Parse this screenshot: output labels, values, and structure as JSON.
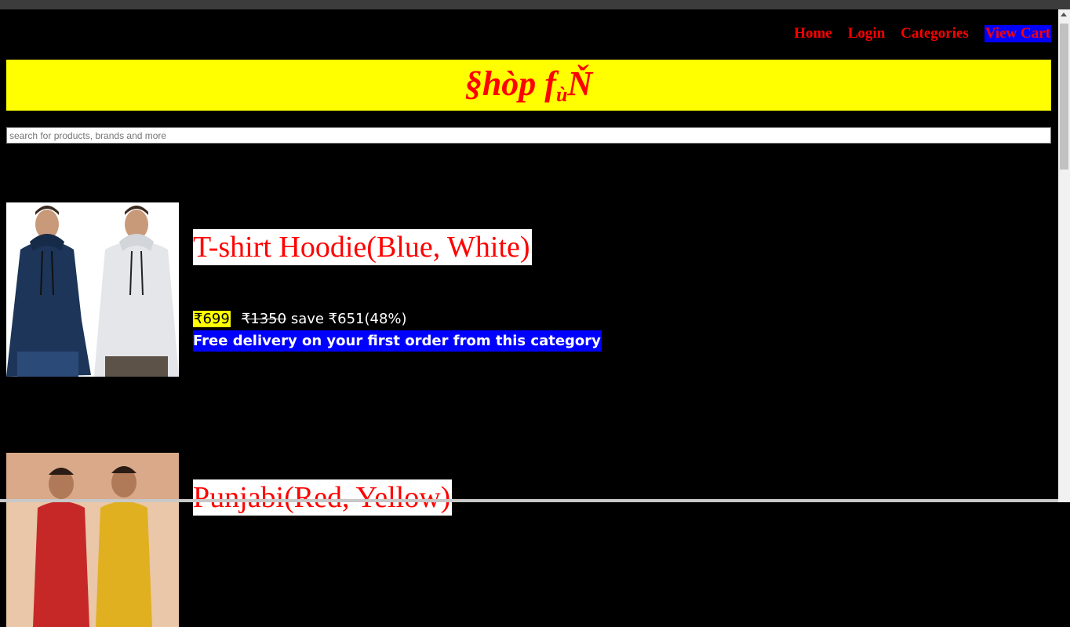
{
  "nav": {
    "home": "Home",
    "login": "Login",
    "categories": "Categories",
    "cart": "View Cart"
  },
  "banner": {
    "title_main": "§hòp f",
    "title_sub": "ù",
    "title_end": "Ň"
  },
  "search": {
    "placeholder": "search for products, brands and more",
    "value": ""
  },
  "products": [
    {
      "name": "T-shirt Hoodie(Blue, White)",
      "price": "₹699",
      "mrp": "₹1350",
      "save": "save ₹651(48%)",
      "delivery": "Free delivery on your first order from this category",
      "image": "hoodie-image"
    },
    {
      "name": "Punjabi(Red, Yellow)",
      "image": "punjabi-image"
    }
  ],
  "colors": {
    "background": "#000000",
    "accent": "#ff0000",
    "banner": "#ffff00",
    "cart_bg": "#0000ff",
    "delivery_bg": "#0000ff"
  }
}
